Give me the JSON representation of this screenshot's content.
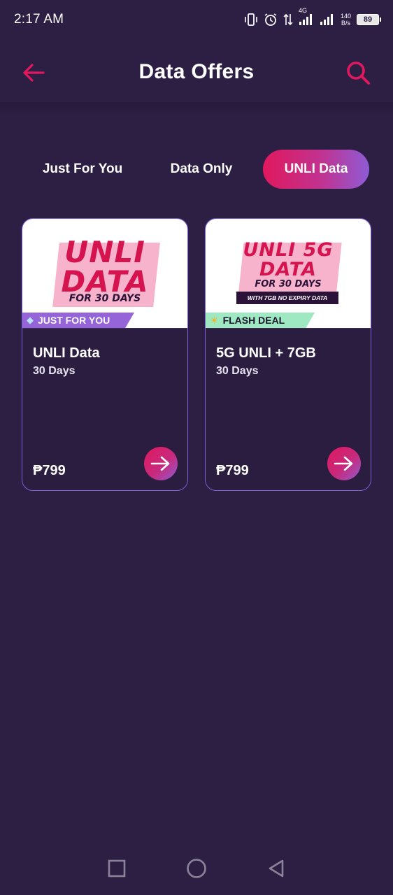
{
  "status_bar": {
    "time": "2:17 AM",
    "network": "4G",
    "speed_value": "140",
    "speed_unit": "B/s",
    "battery": "89"
  },
  "header": {
    "title": "Data Offers",
    "back_icon": "arrow-left-icon",
    "search_icon": "search-icon"
  },
  "tabs": [
    {
      "label": "Just For You",
      "active": false
    },
    {
      "label": "Data Only",
      "active": false
    },
    {
      "label": "UNLI Data",
      "active": true
    }
  ],
  "offers": [
    {
      "banner_line1": "UNLI",
      "banner_line2": "DATA",
      "banner_sub": "FOR 30 DAYS",
      "ribbon": "JUST FOR YOU",
      "ribbon_icon": "diamond-icon",
      "title": "UNLI Data",
      "duration": "30 Days",
      "price": "₱799"
    },
    {
      "banner_line1": "UNLI 5G",
      "banner_line2": "DATA",
      "banner_sub": "FOR 30 DAYS",
      "banner_note": "WITH 7GB NO EXPIRY DATA",
      "ribbon": "FLASH DEAL",
      "ribbon_icon": "sun-icon",
      "title": "5G UNLI + 7GB",
      "duration": "30 Days",
      "price": "₱799"
    }
  ],
  "colors": {
    "background": "#2d1f44",
    "accent": "#e0185e",
    "card_border": "#7a5fd6"
  }
}
